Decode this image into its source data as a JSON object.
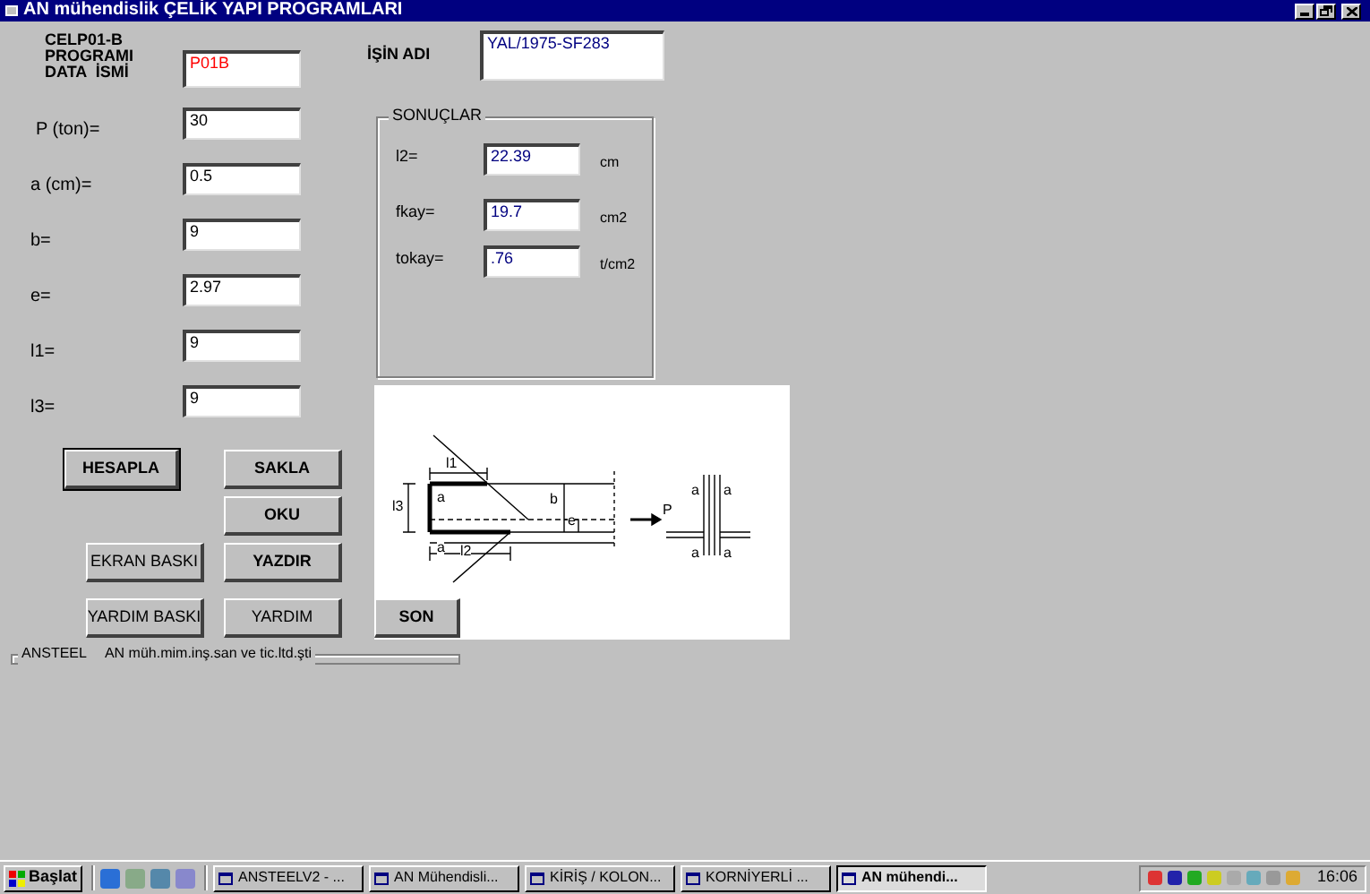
{
  "window": {
    "title": "AN mühendislik  ÇELİK YAPI PROGRAMLARI"
  },
  "program_label": [
    "CELP01-B",
    "PROGRAMI",
    "DATA  İSMİ"
  ],
  "data_name": {
    "value": "P01B"
  },
  "job_name": {
    "label": "İŞİN ADI",
    "value": "YAL/1975-SF283"
  },
  "inputs": [
    {
      "label": "P (ton)=",
      "value": "30"
    },
    {
      "label": "a (cm)=",
      "value": "0.5"
    },
    {
      "label": "b=",
      "value": "9"
    },
    {
      "label": "e=",
      "value": "2.97"
    },
    {
      "label": "l1=",
      "value": "9"
    },
    {
      "label": "l3=",
      "value": "9"
    }
  ],
  "results": {
    "title": "SONUÇLAR",
    "rows": [
      {
        "label": "l2=",
        "value": "22.39",
        "unit": "cm"
      },
      {
        "label": "fkay=",
        "value": "19.7",
        "unit": "cm2"
      },
      {
        "label": "tokay=",
        "value": ".76",
        "unit": "t/cm2"
      }
    ]
  },
  "buttons": [
    {
      "label": "HESAPLA",
      "bold": true,
      "default": true
    },
    {
      "label": "SAKLA",
      "bold": true,
      "default": false
    },
    {
      "label": "OKU",
      "bold": true,
      "default": false
    },
    {
      "label": "EKRAN BASKI",
      "bold": false,
      "default": false
    },
    {
      "label": "YAZDIR",
      "bold": true,
      "default": false
    },
    {
      "label": "YARDIM BASKI",
      "bold": false,
      "default": false
    },
    {
      "label": "YARDIM",
      "bold": false,
      "default": false
    },
    {
      "label": "SON",
      "bold": true,
      "default": false
    }
  ],
  "diagram": {
    "labels": [
      "l1",
      "a",
      "l3",
      "b",
      "e",
      "a",
      "l2",
      "P",
      "a",
      "a",
      "a",
      "a"
    ]
  },
  "status": {
    "title": "ANSTEEL",
    "text": "AN müh.mim.inş.san ve tic.ltd.şti"
  },
  "taskbar": {
    "start": "Başlat",
    "tasks": [
      {
        "label": "ANSTEELV2 - ...",
        "selected": false
      },
      {
        "label": "AN Mühendisli...",
        "selected": false
      },
      {
        "label": "KİRİŞ / KOLON...",
        "selected": false
      },
      {
        "label": "KORNİYERLİ ...",
        "selected": false
      },
      {
        "label": "AN mühendi...",
        "selected": true
      }
    ],
    "clock": "16:06"
  }
}
